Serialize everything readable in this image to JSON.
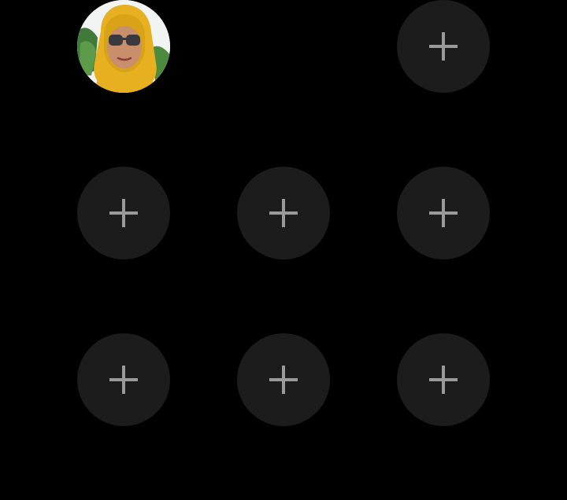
{
  "icons": {
    "add": "plus-icon",
    "avatar": "contact-avatar"
  },
  "colors": {
    "background": "#000000",
    "slot_fill": "#1c1c1c",
    "plus_stroke": "#9a9a9a",
    "avatar_scarf": "#e6b020"
  },
  "grid": {
    "rows": 3,
    "columns": 3,
    "slots": [
      {
        "kind": "avatar"
      },
      {
        "kind": "empty"
      },
      {
        "kind": "add"
      },
      {
        "kind": "add"
      },
      {
        "kind": "add"
      },
      {
        "kind": "add"
      },
      {
        "kind": "add"
      },
      {
        "kind": "add"
      },
      {
        "kind": "add"
      }
    ]
  }
}
